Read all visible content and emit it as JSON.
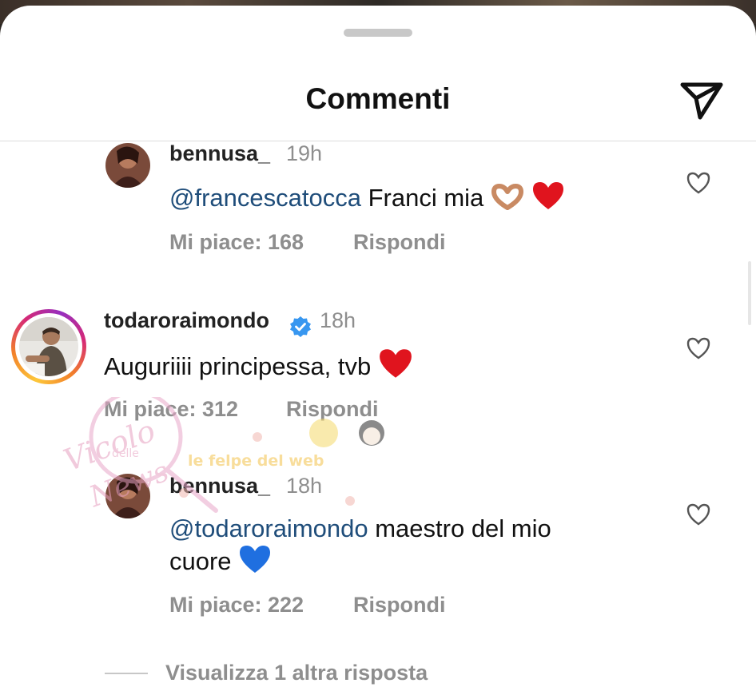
{
  "header": {
    "title": "Commenti",
    "send_icon": "paper-plane-icon"
  },
  "comments": [
    {
      "username": "bennusa_",
      "time": "19h",
      "mention": "@francescatocca",
      "text": " Franci mia",
      "emojis": "heart-hands, red-heart",
      "likes": "Mi piace: 168",
      "reply": "Rispondi"
    },
    {
      "username": "todaroraimondo",
      "verified": true,
      "time": "18h",
      "text": "Auguriiii principessa, tvb",
      "emojis": "red-heart",
      "likes": "Mi piace: 312",
      "reply": "Rispondi"
    },
    {
      "username": "bennusa_",
      "time": "18h",
      "mention": "@todaroraimondo",
      "text_line1": " maestro del mio",
      "text_line2": "cuore",
      "emojis": "blue-heart",
      "likes": "Mi piace: 222",
      "reply": "Rispondi"
    }
  ],
  "view_more": "Visualizza 1 altra risposta",
  "watermark": {
    "text1": "Vicolo",
    "text2": "delle",
    "text3": "News",
    "text4": "le felpe del web"
  },
  "colors": {
    "mention": "#1f4d7a",
    "verified": "#3897f0",
    "muted": "#8e8e8e",
    "heart_red": "#e0141e",
    "heart_blue": "#1f6fe0"
  }
}
